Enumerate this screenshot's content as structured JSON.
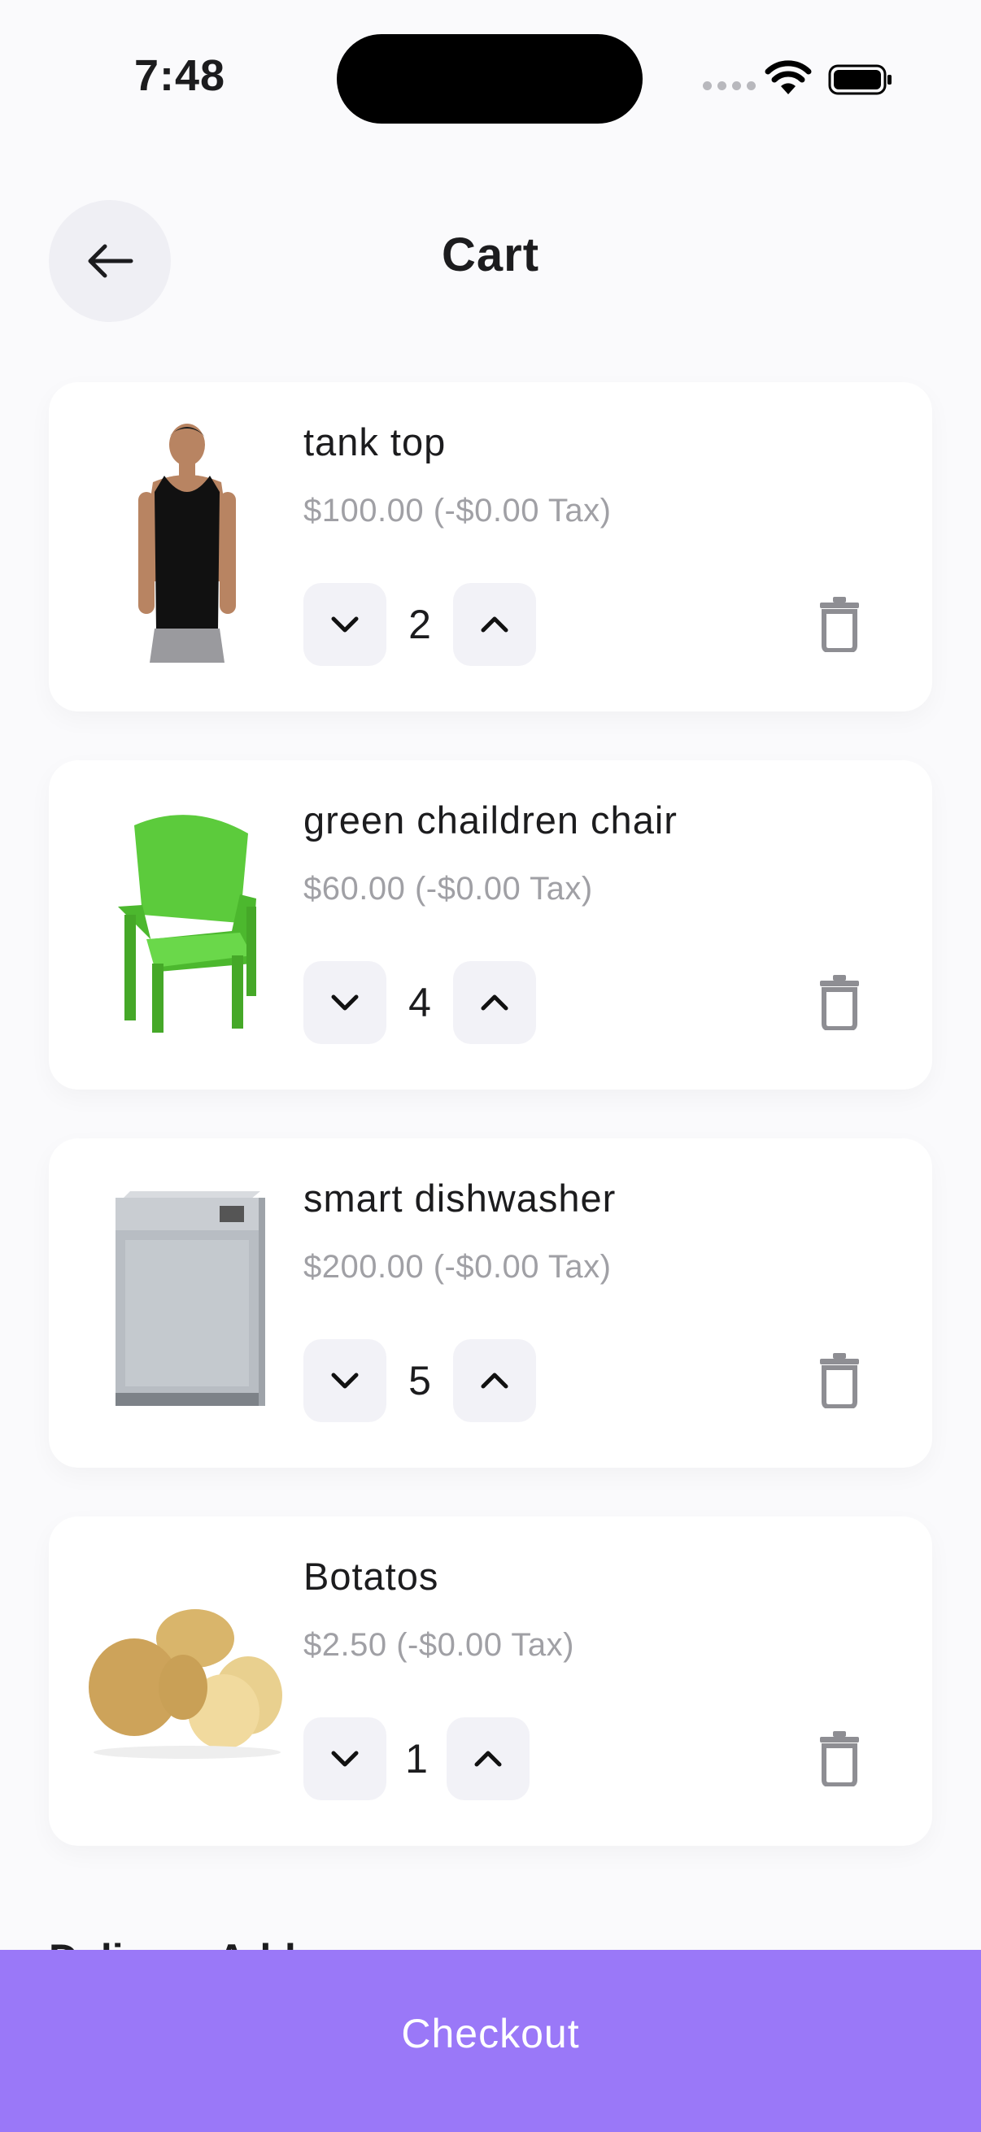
{
  "status_bar": {
    "time": "7:48"
  },
  "header": {
    "title": "Cart",
    "back_icon": "arrow-left-icon"
  },
  "cart": {
    "items": [
      {
        "name": "tank top",
        "price": "$100.00 (-$0.00 Tax)",
        "quantity": "2",
        "image": "tank-top-image"
      },
      {
        "name": "green chaildren chair",
        "price": "$60.00 (-$0.00 Tax)",
        "quantity": "4",
        "image": "green-chair-image"
      },
      {
        "name": "smart dishwasher",
        "price": "$200.00 (-$0.00 Tax)",
        "quantity": "5",
        "image": "dishwasher-image"
      },
      {
        "name": "Botatos",
        "price": "$2.50 (-$0.00 Tax)",
        "quantity": "1",
        "image": "potatoes-image"
      }
    ]
  },
  "delivery": {
    "label_partial": "Delivery Address"
  },
  "checkout": {
    "label": "Checkout"
  },
  "colors": {
    "accent": "#9A78F8",
    "background": "#FAFAFC",
    "muted_text": "#A0A0A5"
  }
}
